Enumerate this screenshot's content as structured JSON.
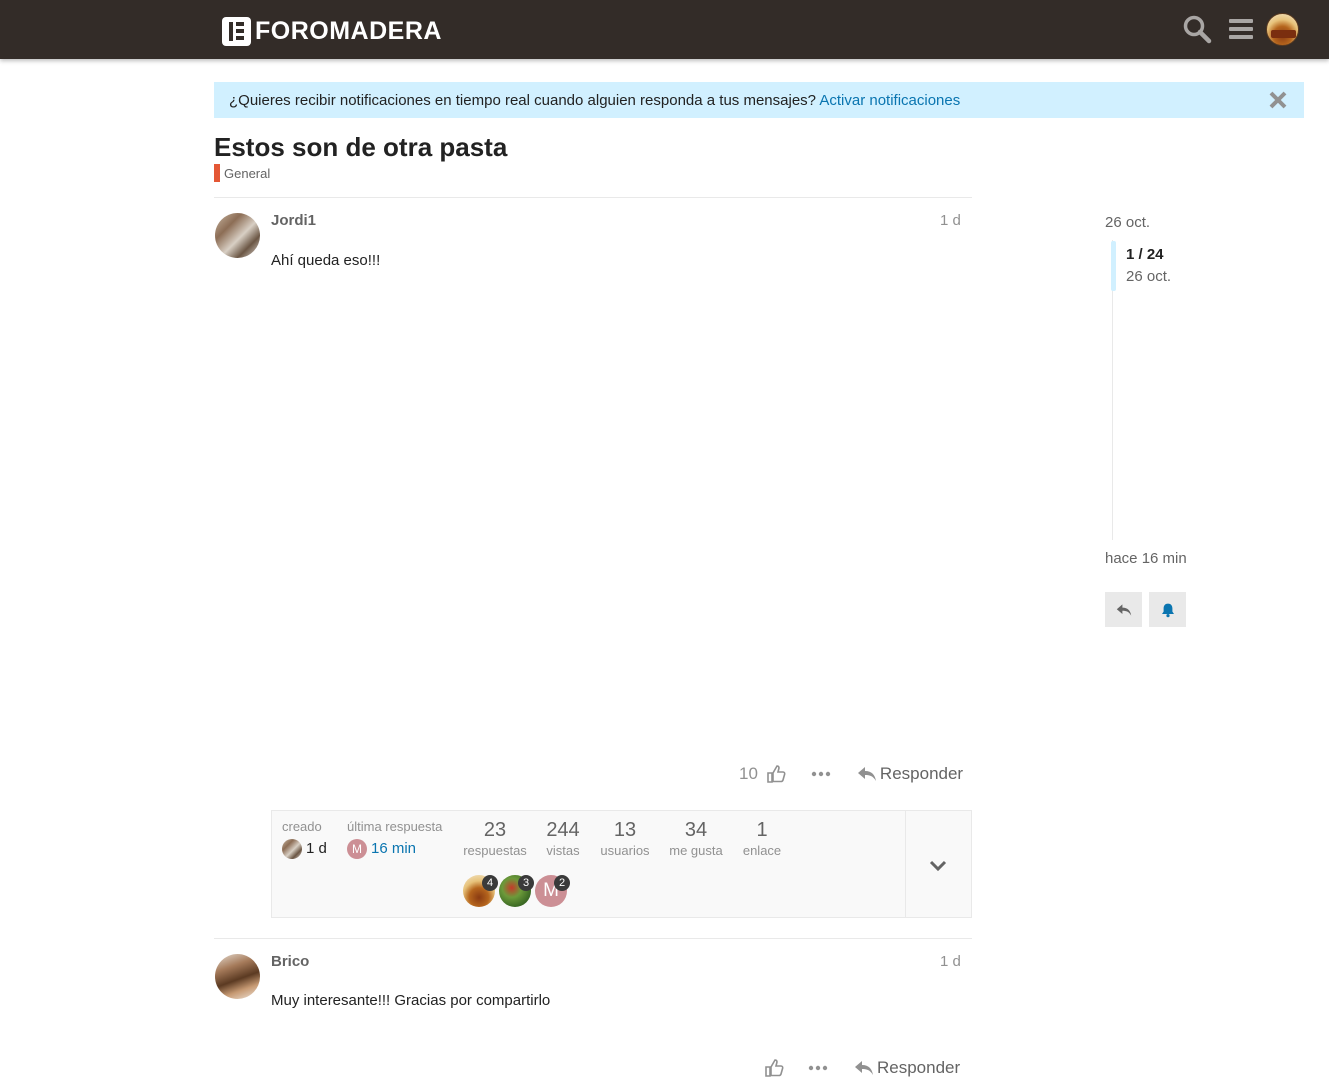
{
  "header": {
    "logo_text": "FOROMADERA",
    "search_icon": "search-icon",
    "menu_icon": "hamburger-menu-icon",
    "avatar_icon": "user-avatar"
  },
  "banner": {
    "text": "¿Quieres recibir notificaciones en tiempo real cuando alguien responda a tus mensajes?",
    "link": "Activar notificaciones",
    "close_icon": "close-icon",
    "background": "#d1f0ff"
  },
  "topic": {
    "title": "Estos son de otra pasta",
    "category": "General",
    "category_color": "#e45735"
  },
  "posts": [
    {
      "username": "Jordi1",
      "date": "1 d",
      "body": "Ahí queda eso!!!",
      "likes": "10",
      "reply_label": "Responder"
    },
    {
      "username": "Brico",
      "date": "1 d",
      "body": "Muy interesante!!! Gracias por compartirlo",
      "likes": "",
      "reply_label": "Responder"
    }
  ],
  "topic_map": {
    "created_label": "creado",
    "created_value": "1 d",
    "last_reply_label": "última respuesta",
    "last_reply_value": "16 min",
    "last_reply_avatar_letter": "M",
    "stats": [
      {
        "value": "23",
        "label": "respuestas"
      },
      {
        "value": "244",
        "label": "vistas"
      },
      {
        "value": "13",
        "label": "usuarios"
      },
      {
        "value": "34",
        "label": "me gusta"
      },
      {
        "value": "1",
        "label": "enlace"
      }
    ],
    "participants": [
      {
        "count": "4"
      },
      {
        "count": "3"
      },
      {
        "letter": "M",
        "count": "2"
      }
    ],
    "expand_icon": "chevron-down-icon"
  },
  "timeline": {
    "top_date": "26 oct.",
    "position": "1 / 24",
    "position_date": "26 oct.",
    "bottom_label": "hace 16 min",
    "reply_icon": "reply-icon",
    "notification_icon": "bell-icon"
  }
}
